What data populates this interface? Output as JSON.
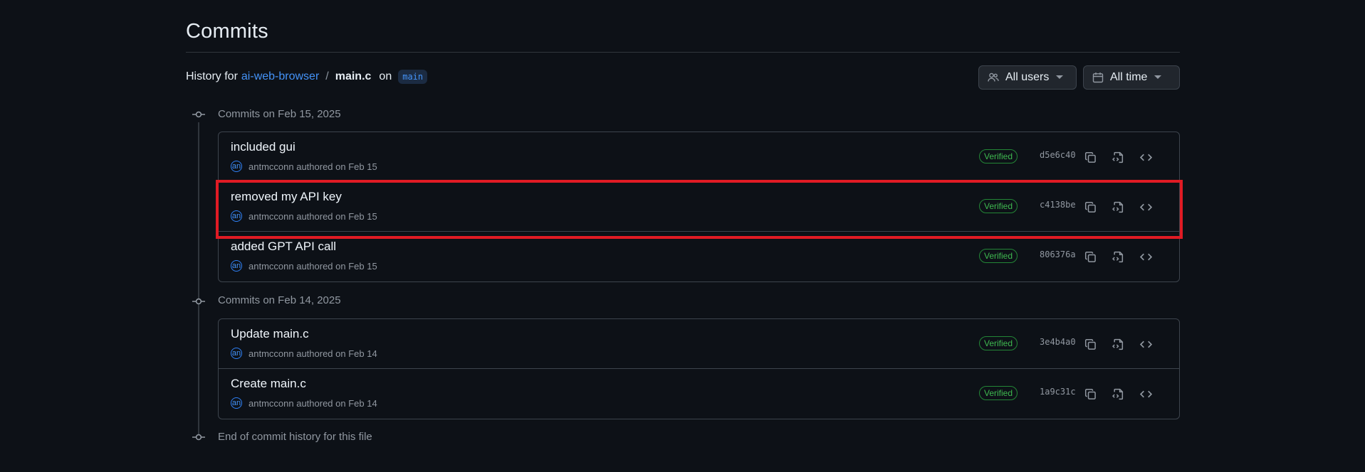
{
  "header": {
    "title": "Commits",
    "history_prefix": "History for",
    "repo": "ai-web-browser",
    "separator": "/",
    "file": "main.c",
    "on": "on",
    "branch": "main"
  },
  "filters": {
    "users_label": "All users",
    "time_label": "All time"
  },
  "groups": [
    {
      "label": "Commits on Feb 15, 2025",
      "commits": [
        {
          "message": "included gui",
          "avatar": "an",
          "author": "antmcconn",
          "authored": "authored on Feb 15",
          "verified": "Verified",
          "sha": "d5e6c40"
        },
        {
          "message": "removed my API key",
          "avatar": "an",
          "author": "antmcconn",
          "authored": "authored on Feb 15",
          "verified": "Verified",
          "sha": "c4138be"
        },
        {
          "message": "added GPT API call",
          "avatar": "an",
          "author": "antmcconn",
          "authored": "authored on Feb 15",
          "verified": "Verified",
          "sha": "806376a"
        }
      ]
    },
    {
      "label": "Commits on Feb 14, 2025",
      "commits": [
        {
          "message": "Update main.c",
          "avatar": "an",
          "author": "antmcconn",
          "authored": "authored on Feb 14",
          "verified": "Verified",
          "sha": "3e4b4a0"
        },
        {
          "message": "Create main.c",
          "avatar": "an",
          "author": "antmcconn",
          "authored": "authored on Feb 14",
          "verified": "Verified",
          "sha": "1a9c31c"
        }
      ]
    }
  ],
  "end_label": "End of commit history for this file",
  "colors": {
    "background": "#0d1117",
    "link": "#4493f8",
    "verified": "#3fb950",
    "highlight": "#e01b24"
  },
  "icons": {
    "users_filter": "people-icon",
    "time_filter": "calendar-icon",
    "timeline_node": "git-commit-icon",
    "copy": "copy-icon",
    "browse": "file-code-icon",
    "code": "code-icon"
  }
}
